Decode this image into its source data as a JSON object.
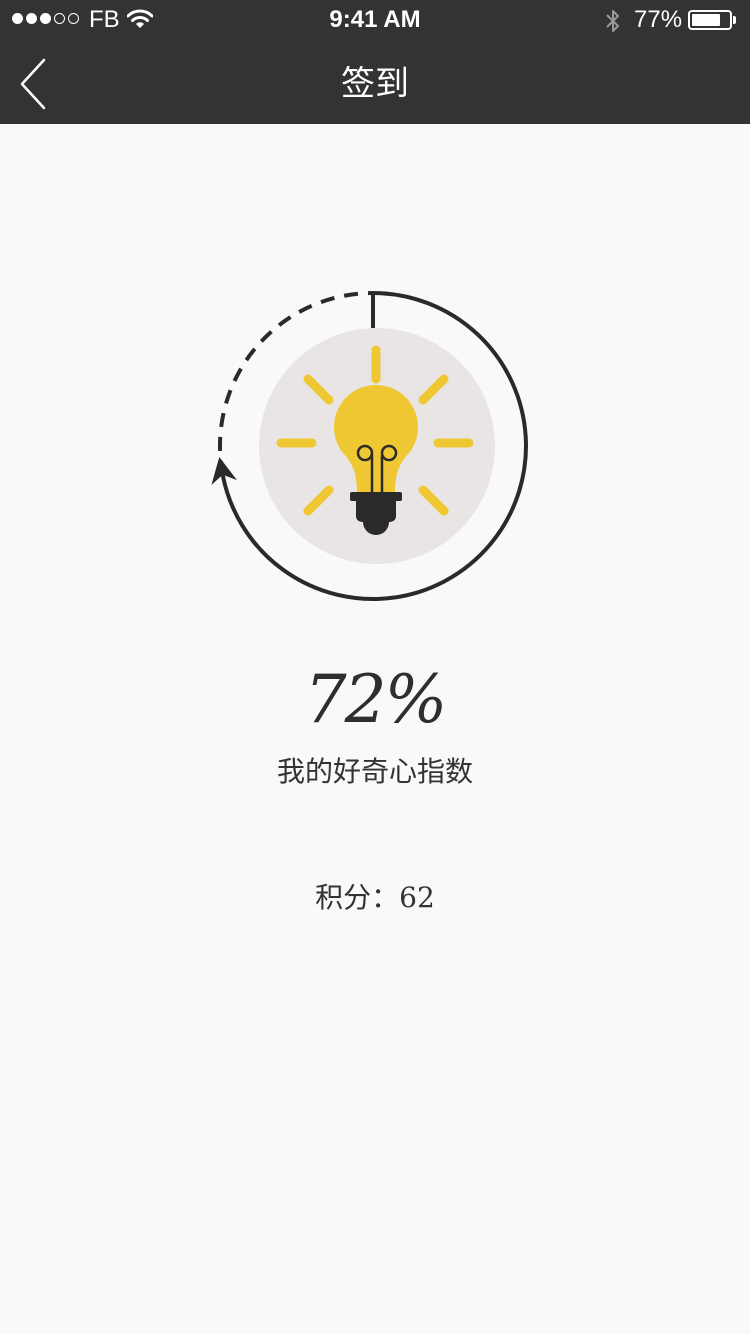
{
  "status_bar": {
    "carrier": "FB",
    "time": "9:41 AM",
    "battery_percent_text": "77%",
    "battery_level": 0.77,
    "signal_filled": 3,
    "signal_total": 5,
    "icons": [
      "signal-dots-icon",
      "wifi-icon",
      "bluetooth-icon",
      "battery-icon"
    ]
  },
  "nav": {
    "back_icon": "chevron-left-icon",
    "title": "签到"
  },
  "progress": {
    "value": 0.72,
    "icon": "lightbulb-icon"
  },
  "main": {
    "percent_text": "72%",
    "index_label": "我的好奇心指数",
    "points_text": "积分：62"
  },
  "colors": {
    "topbar": "#333333",
    "background": "#f9f9f9",
    "bulb_yellow": "#eec732",
    "halo": "#e9e5e4",
    "ring": "#2a2a2a"
  }
}
